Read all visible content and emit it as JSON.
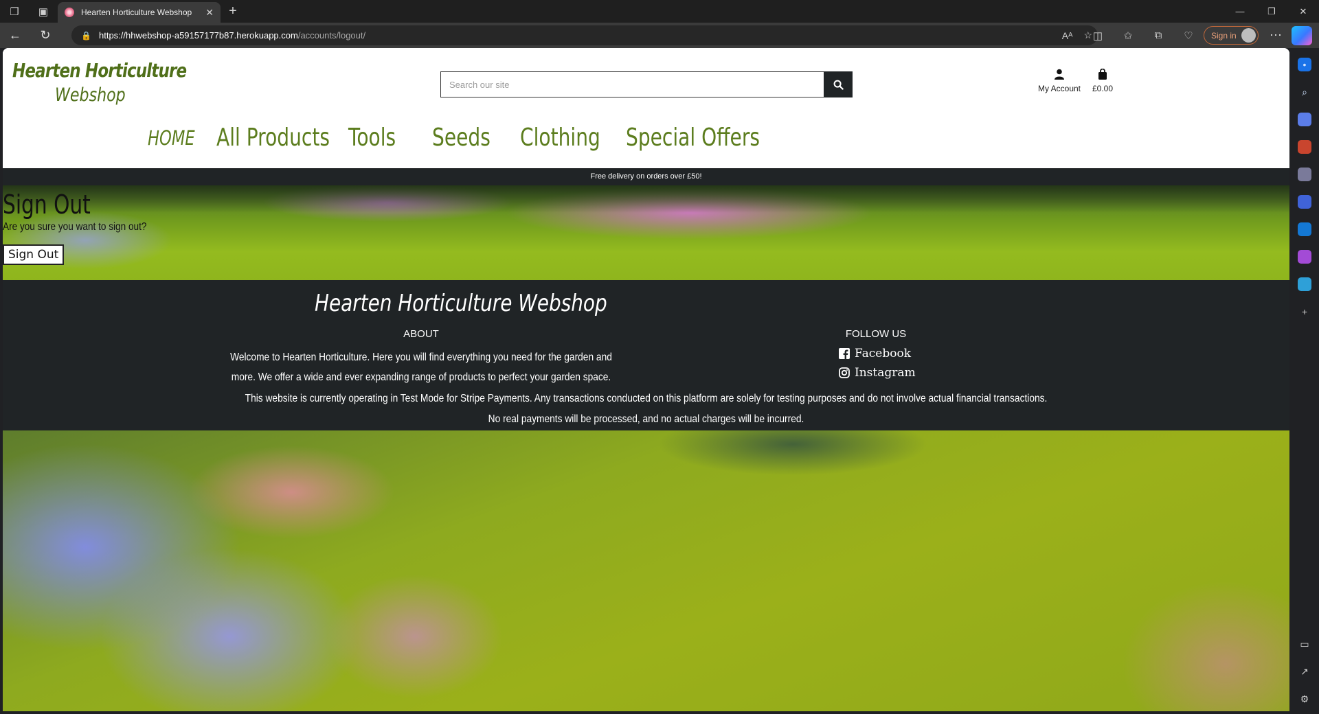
{
  "browser": {
    "tab_title": "Hearten Horticulture Webshop",
    "url_host": "https://hhwebshop-a59157177b87.herokuapp.com",
    "url_path": "/accounts/logout/",
    "sign_in_label": "Sign in",
    "accent_color": "#c2683a"
  },
  "header": {
    "logo_line1": "Hearten Horticulture",
    "logo_line2": "Webshop",
    "search_placeholder": "Search our site",
    "account_label": "My Account",
    "bag_total": "£0.00"
  },
  "nav": {
    "items": [
      {
        "label": "HOME"
      },
      {
        "label": "All Products"
      },
      {
        "label": "Tools"
      },
      {
        "label": "Seeds"
      },
      {
        "label": "Clothing"
      },
      {
        "label": "Special Offers"
      }
    ],
    "color": "#5c7d1e"
  },
  "promo": {
    "text": "Free delivery on orders over £50!"
  },
  "signout": {
    "title": "Sign Out",
    "question": "Are you sure you want to sign out?",
    "button_label": "Sign Out"
  },
  "footer": {
    "title_bold": "Hearten Horticulture",
    "title_light": "Webshop",
    "about_heading": "ABOUT",
    "about_line1": "Welcome to Hearten Horticulture. Here you will find everything you need for the garden and",
    "about_line2": "more. We offer a wide and ever expanding range of products to perfect your garden space.",
    "follow_heading": "FOLLOW US",
    "facebook_label": "Facebook",
    "instagram_label": "Instagram",
    "notice_line1": "This website is currently operating in Test Mode for Stripe Payments. Any transactions conducted on this platform are solely for testing purposes and do not involve actual financial transactions.",
    "notice_line2": "No real payments will be processed, and no actual charges will be incurred."
  }
}
